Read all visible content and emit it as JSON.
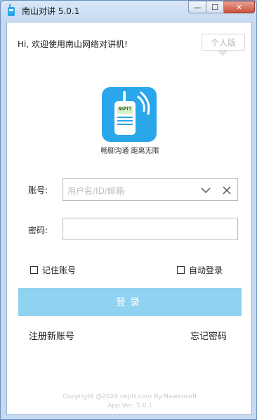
{
  "window": {
    "title": "南山对讲 5.0.1",
    "minimize_glyph": "—",
    "maximize_glyph": "☐",
    "close_glyph": "✕"
  },
  "header": {
    "greeting": "Hi, 欢迎使用南山网络对讲机!",
    "edition_button": "个人版"
  },
  "logo": {
    "badge_text": "NSPTT",
    "slogan": "畅聊沟通 距离无限",
    "accent_color": "#2aa6ea"
  },
  "form": {
    "account_label": "账号:",
    "account_placeholder": "用户名/ID/邮箱",
    "password_label": "密码:",
    "password_value": "",
    "remember_label": "记住账号",
    "remember_checked": false,
    "autologin_label": "自动登录",
    "autologin_checked": false,
    "login_button": "登录",
    "login_button_color": "#8fd2f2"
  },
  "links": {
    "register": "注册新账号",
    "forgot": "忘记密码"
  },
  "footer": {
    "copyright": "Copyright @2024 nsptt.com By:Nawensoft",
    "version": "App Ver: 5.0.1"
  }
}
